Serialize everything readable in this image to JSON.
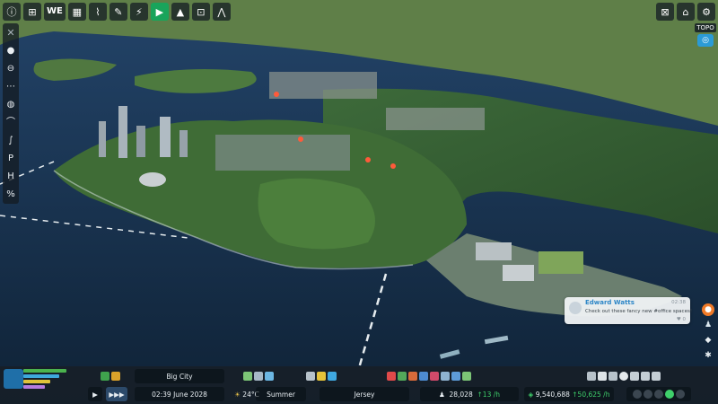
{
  "top_toolbar": {
    "buttons": [
      {
        "name": "info-icon",
        "glyph": "ⓘ"
      },
      {
        "name": "add-icon",
        "glyph": "⊞"
      },
      {
        "name": "we-text",
        "glyph": "WE"
      },
      {
        "name": "graph-icon",
        "glyph": "▦"
      },
      {
        "name": "chart-icon",
        "glyph": "⌇"
      },
      {
        "name": "paint-icon",
        "glyph": "✎"
      },
      {
        "name": "fire-icon",
        "glyph": "⚡"
      },
      {
        "name": "play-icon",
        "glyph": "▶"
      },
      {
        "name": "tree-icon",
        "glyph": "▲"
      },
      {
        "name": "focus-icon",
        "glyph": "⊡"
      },
      {
        "name": "wave-icon",
        "glyph": "⋀"
      }
    ],
    "right_buttons": [
      {
        "name": "lock-icon",
        "glyph": "⊠"
      },
      {
        "name": "graduate-icon",
        "glyph": "⌂"
      },
      {
        "name": "settings-icon",
        "glyph": "⚙"
      }
    ]
  },
  "topo": {
    "label": "TOPO",
    "icon": "layers-icon"
  },
  "left_toolbar": {
    "buttons": [
      {
        "name": "close-icon",
        "glyph": "✕"
      },
      {
        "name": "circle-icon",
        "glyph": "●"
      },
      {
        "name": "minus-icon",
        "glyph": "⊖"
      },
      {
        "name": "dots-icon",
        "glyph": "⋯"
      },
      {
        "name": "globe-icon",
        "glyph": "◍"
      },
      {
        "name": "curve-icon",
        "glyph": "⌒"
      },
      {
        "name": "s-curve-icon",
        "glyph": "∫"
      },
      {
        "name": "anchor-icon",
        "glyph": "P"
      },
      {
        "name": "ladder-icon",
        "glyph": "H"
      },
      {
        "name": "percent-icon",
        "glyph": "%"
      }
    ]
  },
  "chirp": {
    "author": "Edward Watts",
    "time": "02:38",
    "message": "Check out these fancy new #office spaces!",
    "reaction": "♥ 0"
  },
  "bottom_bar": {
    "city_name": "Big City",
    "time": "02:39",
    "date": "June 2028",
    "temperature": "24°C",
    "season": "Summer",
    "theme": "Jersey",
    "population": "28,028",
    "population_rate": "↑13 /h",
    "money": "9,540,688",
    "money_rate": "↑50,625 /h",
    "speed_buttons": [
      "▶",
      "▶▶▶"
    ]
  },
  "colors": {
    "accent_green": "#19a45b",
    "topo_blue": "#2b9bd6",
    "chirp_author": "#2d86c7",
    "bar_dark": "#161f28"
  }
}
